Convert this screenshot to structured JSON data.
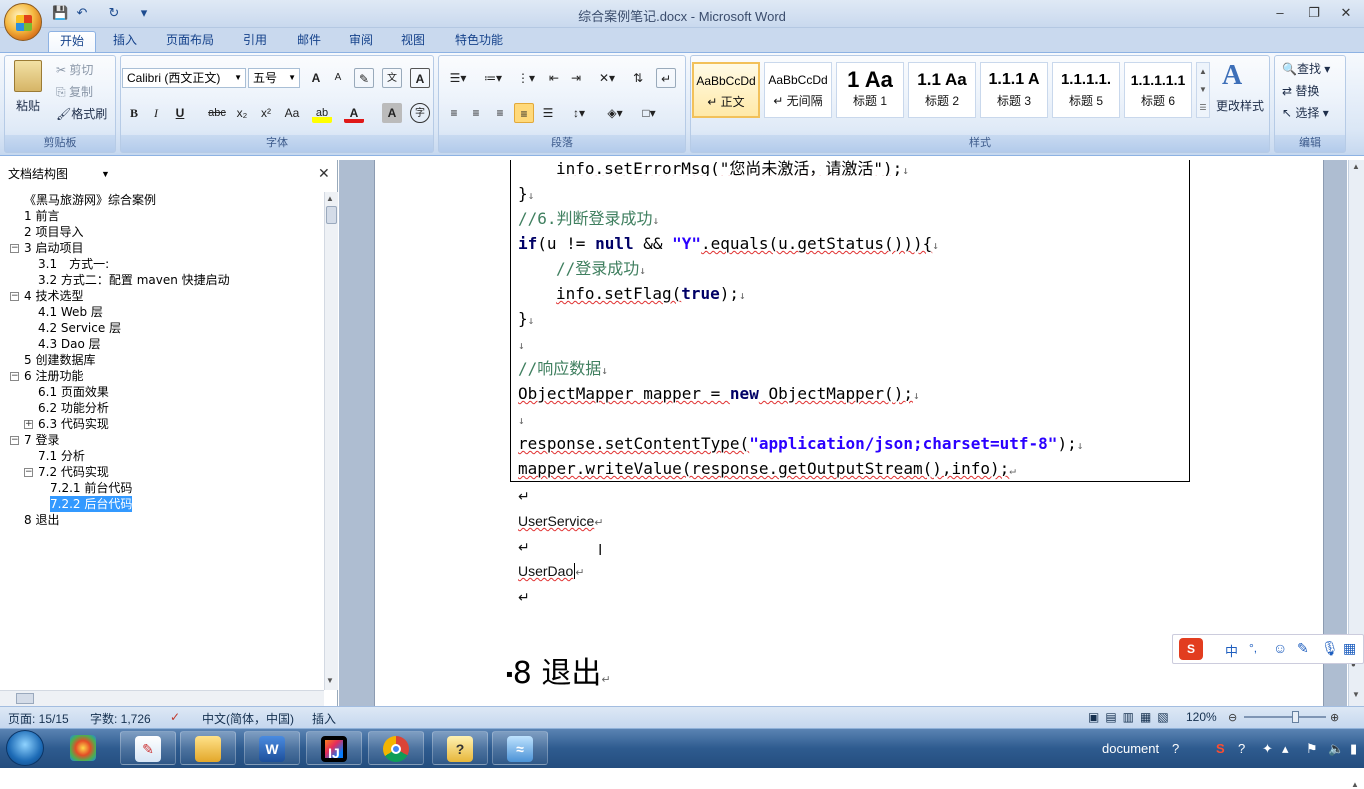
{
  "window": {
    "title": "综合案例笔记.docx - Microsoft Word"
  },
  "qat": {
    "save": "💾",
    "undo": "↶",
    "redo": "↻",
    "more": "▾"
  },
  "window_controls": {
    "minimize": "–",
    "restore": "❐",
    "close": "✕"
  },
  "ribbon_tabs": [
    "开始",
    "插入",
    "页面布局",
    "引用",
    "邮件",
    "审阅",
    "视图",
    "特色功能"
  ],
  "clipboard": {
    "paste": "粘贴",
    "cut": "剪切",
    "copy": "复制",
    "format_painter": "格式刷",
    "label": "剪贴板"
  },
  "font": {
    "name": "Calibri (西文正文)",
    "size": "五号",
    "label": "字体",
    "buttons": {
      "grow": "A",
      "shrink": "A",
      "bold": "B",
      "italic": "I",
      "underline": "U",
      "strike": "abc",
      "sub": "x₂",
      "sup": "x²",
      "case": "Aa",
      "highlight": "ab",
      "color": "A",
      "charshade": "A",
      "encircle": "字"
    }
  },
  "paragraph": {
    "label": "段落"
  },
  "styles": {
    "label": "样式",
    "change": "更改样式",
    "items": [
      {
        "preview": "AaBbCcDd",
        "name": "↵ 正文"
      },
      {
        "preview": "AaBbCcDd",
        "name": "↵ 无间隔"
      },
      {
        "preview": "1  Aa",
        "name": "标题 1"
      },
      {
        "preview": "1.1  Aa",
        "name": "标题 2"
      },
      {
        "preview": "1.1.1  A",
        "name": "标题 3"
      },
      {
        "preview": "1.1.1.1.",
        "name": "标题 5"
      },
      {
        "preview": "1.1.1.1.1",
        "name": "标题 6"
      }
    ]
  },
  "editing": {
    "label": "编辑",
    "find": "查找",
    "replace": "替换",
    "select": "选择"
  },
  "nav": {
    "title": "文档结构图",
    "close": "✕",
    "items": [
      {
        "text": "《黑马旅游网》综合案例",
        "indent": 0,
        "toggle": ""
      },
      {
        "text": "1 前言",
        "indent": 1,
        "toggle": ""
      },
      {
        "text": "2 项目导入",
        "indent": 1,
        "toggle": ""
      },
      {
        "text": "3 启动项目",
        "indent": 1,
        "toggle": "−"
      },
      {
        "text": "3.1　方式一:",
        "indent": 2,
        "toggle": ""
      },
      {
        "text": "3.2 方式二：配置 maven 快捷启动",
        "indent": 2,
        "toggle": ""
      },
      {
        "text": "4 技术选型",
        "indent": 1,
        "toggle": "−"
      },
      {
        "text": "4.1 Web 层",
        "indent": 2,
        "toggle": ""
      },
      {
        "text": "4.2 Service 层",
        "indent": 2,
        "toggle": ""
      },
      {
        "text": "4.3 Dao 层",
        "indent": 2,
        "toggle": ""
      },
      {
        "text": "5 创建数据库",
        "indent": 1,
        "toggle": ""
      },
      {
        "text": "6 注册功能",
        "indent": 1,
        "toggle": "−"
      },
      {
        "text": "6.1 页面效果",
        "indent": 2,
        "toggle": ""
      },
      {
        "text": "6.2 功能分析",
        "indent": 2,
        "toggle": ""
      },
      {
        "text": "6.3 代码实现",
        "indent": 2,
        "toggle": "+"
      },
      {
        "text": "7 登录",
        "indent": 1,
        "toggle": "−"
      },
      {
        "text": "7.1 分析",
        "indent": 2,
        "toggle": ""
      },
      {
        "text": "7.2 代码实现",
        "indent": 2,
        "toggle": "−"
      },
      {
        "text": "7.2.1 前台代码",
        "indent": 3,
        "toggle": ""
      },
      {
        "text": "7.2.2 后台代码",
        "indent": 3,
        "toggle": "",
        "selected": true
      },
      {
        "text": "8 退出",
        "indent": 1,
        "toggle": ""
      }
    ]
  },
  "code": {
    "l0": "info.setErrorMsg(\"您尚未激活，请激活\");",
    "l1": "}",
    "l2": "//6.判断登录成功",
    "l3a": "if",
    "l3b": "(u != ",
    "l3c": "null",
    "l3d": " && ",
    "l3e": "\"Y\"",
    "l3f": ".equals(u.getStatus())){",
    "l4": "//登录成功",
    "l5a": "info.setFlag(",
    "l5b": "true",
    "l5c": ");",
    "l6": "}",
    "l8": "//响应数据",
    "l9a": "ObjectMapper mapper = ",
    "l9b": "new",
    "l9c": " ObjectMapper();",
    "l11a": "response.setContentType(",
    "l11b": "\"application/json;charset=utf-8\"",
    "l11c": ");",
    "l12": "mapper.writeValue(response.getOutputStream(),info);"
  },
  "body": {
    "p1": "UserService",
    "p2": "UserDao",
    "heading": "8  退出"
  },
  "status": {
    "page": "页面: 15/15",
    "words": "字数: 1,726",
    "lang": "中文(简体，中国)",
    "mode": "插入",
    "zoom": "120%"
  },
  "ime": {
    "mode": "中",
    "punct": "°,"
  },
  "taskbar": {
    "apps": [
      "Paint",
      "Explorer",
      "Word",
      "IntelliJ IDEA",
      "Chrome",
      "Help",
      "Dolphin"
    ],
    "tray_text": "document"
  }
}
